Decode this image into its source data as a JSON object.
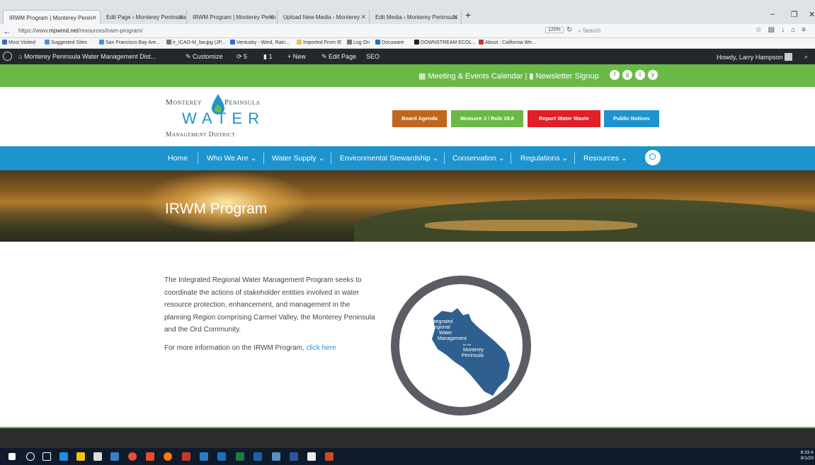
{
  "browser": {
    "tabs": [
      {
        "label": "IRWM Program | Monterey Penin"
      },
      {
        "label": "Edit Page ‹ Monterey Peninsula"
      },
      {
        "label": "IRWM Program | Monterey Penin"
      },
      {
        "label": "Upload New Media ‹ Monterey"
      },
      {
        "label": "Edit Media ‹ Monterey Peninsula"
      }
    ],
    "url_prefix": "https://www.",
    "url_host": "mpwmd.net",
    "url_path": "/resources/irwm-program/",
    "zoom": "120%",
    "search_placeholder": "Search",
    "bookmarks": [
      {
        "label": "Most Visited",
        "color": "#3b6db3"
      },
      {
        "label": "Suggested Sites",
        "color": "#4a90e2"
      },
      {
        "label": "San Francisco Bay Are...",
        "color": "#4a90e2"
      },
      {
        "label": "ir_ICAO-M_bw.jpg (JP...",
        "color": "#777777"
      },
      {
        "label": "Ventusky - Wind, Rain...",
        "color": "#2e6fd0"
      },
      {
        "label": "Imported From IE",
        "color": "#f0c040"
      },
      {
        "label": "Log On",
        "color": "#777777"
      },
      {
        "label": "Docuware",
        "color": "#2a6fb5"
      },
      {
        "label": "DOWNSTREAM ECOL...",
        "color": "#222222"
      },
      {
        "label": "About : California We...",
        "color": "#c33333"
      }
    ]
  },
  "adminbar": {
    "site": "Monterey Peninsula Water Management Dist...",
    "customize": "Customize",
    "updates": "5",
    "comments": "1",
    "new": "New",
    "edit": "Edit Page",
    "seo": "SEO",
    "howdy": "Howdy, Larry Hampson"
  },
  "topbar": {
    "calendar": "Meeting & Events Calendar",
    "divider": "|",
    "newsletter": "Newsletter Signup",
    "social": [
      "f",
      "g",
      "t",
      "y"
    ]
  },
  "logo": {
    "line1a": "Monterey",
    "line1b": "Peninsula",
    "water": "WATER",
    "line3": "Management District"
  },
  "header_buttons": [
    {
      "label": "Board Agenda",
      "color": "#c0661d"
    },
    {
      "label": "Measure J / Rule 19.8",
      "color": "#6ab947"
    },
    {
      "label": "Report Water Waste",
      "color": "#e01f26"
    },
    {
      "label": "Public Notices",
      "color": "#1e94cf"
    }
  ],
  "menu": [
    {
      "label": "Home",
      "caret": ""
    },
    {
      "label": "Who We Are",
      "caret": "⌄"
    },
    {
      "label": "Water Supply",
      "caret": "⌄"
    },
    {
      "label": "Environmental Stewardship",
      "caret": "⌄"
    },
    {
      "label": "Conservation",
      "caret": "⌄"
    },
    {
      "label": "Regulations",
      "caret": "⌄"
    },
    {
      "label": "Resources",
      "caret": "⌄"
    }
  ],
  "hero": {
    "title": "IRWM Program"
  },
  "content": {
    "paragraph": "The Integrated Regional Water Management Program seeks to coordinate the actions of stakeholder entities involved in water resource protection, enhancement, and management in the planning Region comprising Carmel Valley, the Monterey Peninsula and the Ord Community.",
    "more_prefix": "For more information on the IRWM Program, ",
    "more_link": "click here"
  },
  "irwm_logo": {
    "line1": "Integrated",
    "line2": "Regional",
    "line3": "Water",
    "line4": "Management",
    "line5": "for the",
    "line6": "Monterey",
    "line7": "Peninsula"
  },
  "taskbar": {
    "time": "8:33 A",
    "date": "8/1/20"
  }
}
